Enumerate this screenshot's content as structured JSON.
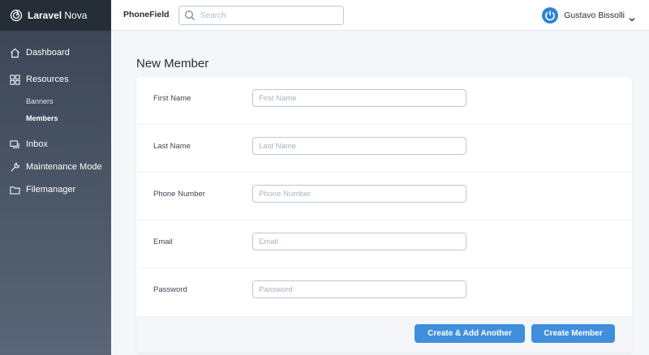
{
  "brand": {
    "name_bold": "Laravel",
    "name_light": "Nova",
    "icon": "nova-logo-icon"
  },
  "topbar": {
    "app_title": "PhoneField",
    "search_placeholder": "Search",
    "user_name": "Gustavo Bissolli"
  },
  "sidebar": {
    "items": [
      {
        "label": "Dashboard",
        "icon": "home-icon"
      },
      {
        "label": "Resources",
        "icon": "grid-icon"
      },
      {
        "label": "Inbox",
        "icon": "chat-icon"
      },
      {
        "label": "Maintenance Mode",
        "icon": "wrench-icon"
      },
      {
        "label": "Filemanager",
        "icon": "folder-icon"
      }
    ],
    "sub_items": [
      {
        "label": "Banners",
        "active": false
      },
      {
        "label": "Members",
        "active": true
      }
    ]
  },
  "form": {
    "title": "New Member",
    "fields": [
      {
        "label": "First Name",
        "placeholder": "First Name",
        "value": ""
      },
      {
        "label": "Last Name",
        "placeholder": "Last Name",
        "value": ""
      },
      {
        "label": "Phone Number",
        "placeholder": "Phone Number",
        "value": ""
      },
      {
        "label": "Email",
        "placeholder": "Email",
        "value": ""
      },
      {
        "label": "Password",
        "placeholder": "Password",
        "value": ""
      }
    ],
    "buttons": {
      "create_another": "Create & Add Another",
      "create": "Create Member"
    }
  },
  "colors": {
    "primary": "#3f8fdc",
    "sidebar_top": "#394353",
    "sidebar_bottom": "#5a6677",
    "brand_bar": "#252d37",
    "background": "#f4f6f9"
  }
}
